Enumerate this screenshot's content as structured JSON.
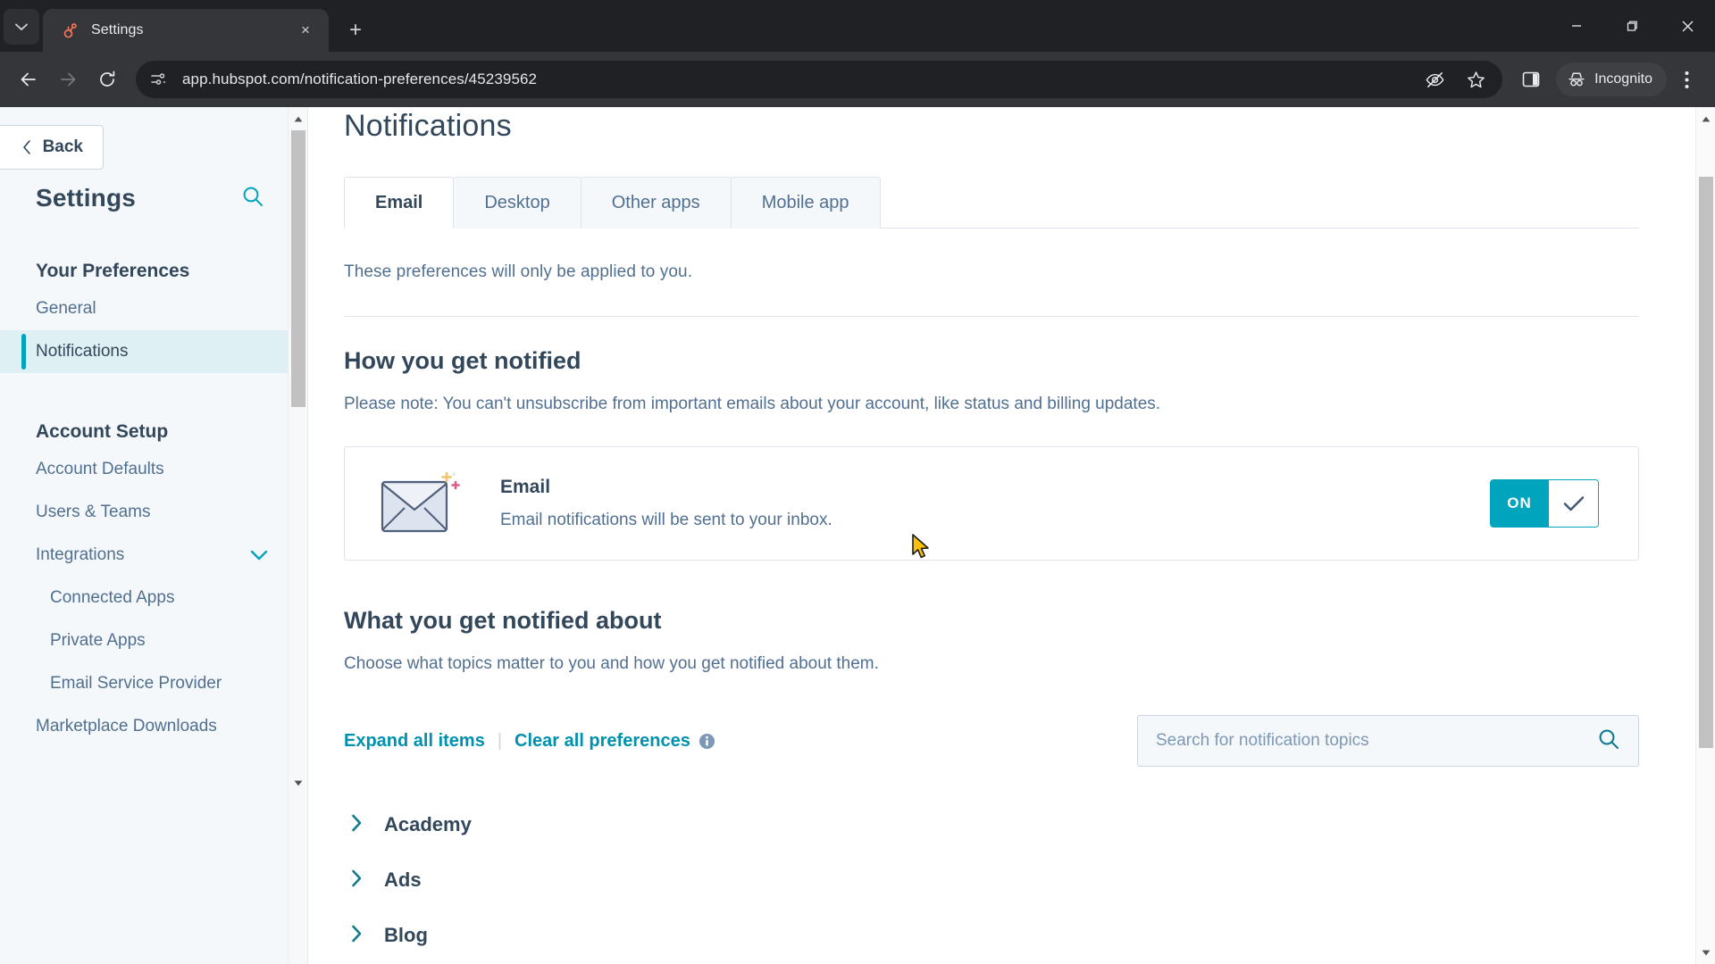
{
  "browser": {
    "tab": {
      "title": "Settings",
      "favicon": "hubspot-sprocket-icon",
      "close_label": "×"
    },
    "new_tab_label": "+",
    "tab_list_icon": "chevron-down-icon",
    "window": {
      "minimize": "—",
      "maximize": "❐",
      "close": "✕"
    },
    "nav": {
      "back": "←",
      "forward": "→",
      "reload": "⟳"
    },
    "omnibox": {
      "url": "app.hubspot.com/notification-preferences/45239562",
      "site_settings_icon": "site-settings-icon",
      "tracking_protection_icon": "eye-slash-icon",
      "bookmark_icon": "star-icon",
      "side_panel_icon": "side-panel-icon"
    },
    "incognito": {
      "label": "Incognito",
      "icon": "incognito-hat-icon"
    },
    "menu_icon": "three-dot-menu-icon"
  },
  "sidebar": {
    "back_label": "Back",
    "back_icon": "chevron-left-icon",
    "title": "Settings",
    "search_icon": "search-icon",
    "groups": [
      {
        "title": "Your Preferences",
        "items": [
          {
            "label": "General",
            "active": false
          },
          {
            "label": "Notifications",
            "active": true
          }
        ]
      },
      {
        "title": "Account Setup",
        "items": [
          {
            "label": "Account Defaults",
            "active": false
          },
          {
            "label": "Users & Teams",
            "active": false
          },
          {
            "label": "Integrations",
            "active": false,
            "expanded": true,
            "caret": "chevron-down-icon"
          },
          {
            "label": "Connected Apps",
            "active": false,
            "sub": true
          },
          {
            "label": "Private Apps",
            "active": false,
            "sub": true
          },
          {
            "label": "Email Service Provider",
            "active": false,
            "sub": true
          },
          {
            "label": "Marketplace Downloads",
            "active": false
          }
        ]
      }
    ]
  },
  "main": {
    "page_title": "Notifications",
    "tabs": [
      {
        "label": "Email",
        "active": true
      },
      {
        "label": "Desktop",
        "active": false
      },
      {
        "label": "Other apps",
        "active": false
      },
      {
        "label": "Mobile app",
        "active": false
      }
    ],
    "scope_note": "These preferences will only be applied to you.",
    "how_section": {
      "heading": "How you get notified",
      "note": "Please note: You can't unsubscribe from important emails about your account, like status and billing updates.",
      "channel": {
        "icon": "envelope-icon",
        "title": "Email",
        "description": "Email notifications will be sent to your inbox.",
        "toggle_label": "ON",
        "toggle_state": "on",
        "toggle_check_icon": "check-icon"
      }
    },
    "what_section": {
      "heading": "What you get notified about",
      "note": "Choose what topics matter to you and how you get notified about them.",
      "expand_all_label": "Expand all items",
      "separator": "|",
      "clear_all_label": "Clear all preferences",
      "info_icon": "info-icon"
    },
    "search": {
      "placeholder": "Search for notification topics",
      "value": "",
      "icon": "search-icon"
    },
    "topics": [
      {
        "label": "Academy",
        "chevron": "chevron-right-icon"
      },
      {
        "label": "Ads",
        "chevron": "chevron-right-icon"
      },
      {
        "label": "Blog",
        "chevron": "chevron-right-icon"
      }
    ]
  },
  "colors": {
    "accent_teal": "#00a4bd",
    "link_teal": "#0091ae",
    "text_dark": "#33475b",
    "text_muted": "#516f90",
    "sidebar_bg": "#f5f8fa",
    "active_item_bg": "#dff0f5"
  }
}
